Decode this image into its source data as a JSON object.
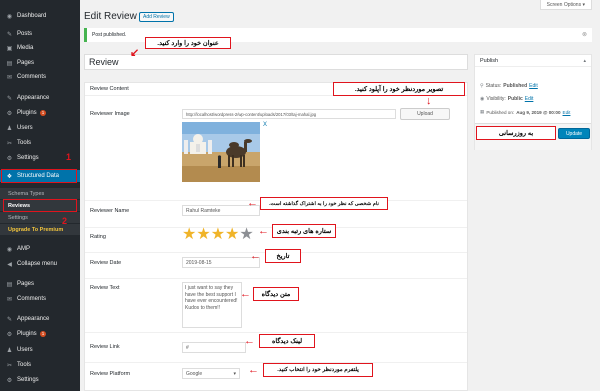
{
  "sidebar": {
    "items": [
      {
        "label": "Dashboard",
        "icon": "dashboard-icon",
        "glyph": "◉"
      },
      {
        "label": "Posts",
        "icon": "pin-icon",
        "glyph": "✎"
      },
      {
        "label": "Media",
        "icon": "media-icon",
        "glyph": "▣"
      },
      {
        "label": "Pages",
        "icon": "pages-icon",
        "glyph": "▤"
      },
      {
        "label": "Comments",
        "icon": "comments-icon",
        "glyph": "✉"
      },
      {
        "label": "Appearance",
        "icon": "appearance-icon",
        "glyph": "✎"
      },
      {
        "label": "Plugins",
        "icon": "plugins-icon",
        "glyph": "⚙",
        "badge": "1"
      },
      {
        "label": "Users",
        "icon": "users-icon",
        "glyph": "♟"
      },
      {
        "label": "Tools",
        "icon": "tools-icon",
        "glyph": "✂"
      },
      {
        "label": "Settings",
        "icon": "settings-icon",
        "glyph": "⚙"
      },
      {
        "label": "Structured Data",
        "icon": "structured-data-icon",
        "glyph": "❖"
      }
    ],
    "submenu": [
      "Schema Types",
      "Reviews",
      "Settings",
      "Upgrade To Premium"
    ],
    "lower_items": [
      {
        "label": "AMP",
        "icon": "amp-icon",
        "glyph": "◉"
      },
      {
        "label": "Collapse menu",
        "icon": "collapse-icon",
        "glyph": "◀"
      },
      {
        "label": "Pages",
        "icon": "pages-icon",
        "glyph": "▤"
      },
      {
        "label": "Comments",
        "icon": "comments-icon",
        "glyph": "✉"
      },
      {
        "label": "Appearance",
        "icon": "appearance-icon",
        "glyph": "✎"
      },
      {
        "label": "Plugins",
        "icon": "plugins-icon",
        "glyph": "⚙",
        "badge": "1"
      },
      {
        "label": "Users",
        "icon": "users-icon",
        "glyph": "♟"
      },
      {
        "label": "Tools",
        "icon": "tools-icon",
        "glyph": "✂"
      },
      {
        "label": "Settings",
        "icon": "settings-icon",
        "glyph": "⚙"
      }
    ],
    "markers": [
      "1",
      "2"
    ]
  },
  "header": {
    "screen_options": "Screen Options ▾",
    "title": "Edit Review",
    "add_button": "Add Review"
  },
  "notice": {
    "text": "Post published.",
    "dismiss": "⊗"
  },
  "post_title": "Review",
  "content": {
    "heading": "Review Content",
    "image_label": "Reviewer Image",
    "image_url": "http://localhost/wordpress-2/wp-content/uploads/2017/03/taj-mahal.jpg",
    "upload_label": "Upload",
    "image_remove": "X",
    "name_label": "Reviewer Name",
    "name_value": "Rahul Ramteke",
    "rating_label": "Rating",
    "rating": 4,
    "rating_max": 5,
    "date_label": "Review Date",
    "date_value": "2019-08-15",
    "text_label": "Review Text",
    "text_value": "I just want to say they have the best support I have ever encountered! Kudos to them!!",
    "link_label": "Review Link",
    "link_value": "#",
    "platform_label": "Review Platform",
    "platform_value": "Google"
  },
  "publish": {
    "heading": "Publish",
    "status_label": "Status:",
    "status_value": "Published",
    "visibility_label": "Visibility:",
    "visibility_value": "Public",
    "published_label": "Published on:",
    "published_value": "Aug 9, 2019 @ 00:00",
    "edit_link": "Edit",
    "update_label": "Update"
  },
  "annotations": {
    "title_note": "عنوان خود را وارد کنید.",
    "upload_note": "تصویر موردنظر خود را آپلود کنید.",
    "update_note": "به روزرسانی",
    "name_note": "نام شخصی که نظر خود را به اشتراک گذاشته است.",
    "rating_note": "ستاره های رتبه بندی",
    "date_note": "تاریخ",
    "text_note": "متن دیدگاه",
    "link_note": "لینک دیدگاه",
    "platform_note": "پلتفرم موردنظر خود را انتخاب کنید."
  },
  "colors": {
    "sidebar_bg": "#23282d",
    "active_bg": "#0073aa",
    "annotation_red": "#e0141d",
    "star_gold": "#f0b429",
    "button_blue": "#0085ba"
  }
}
